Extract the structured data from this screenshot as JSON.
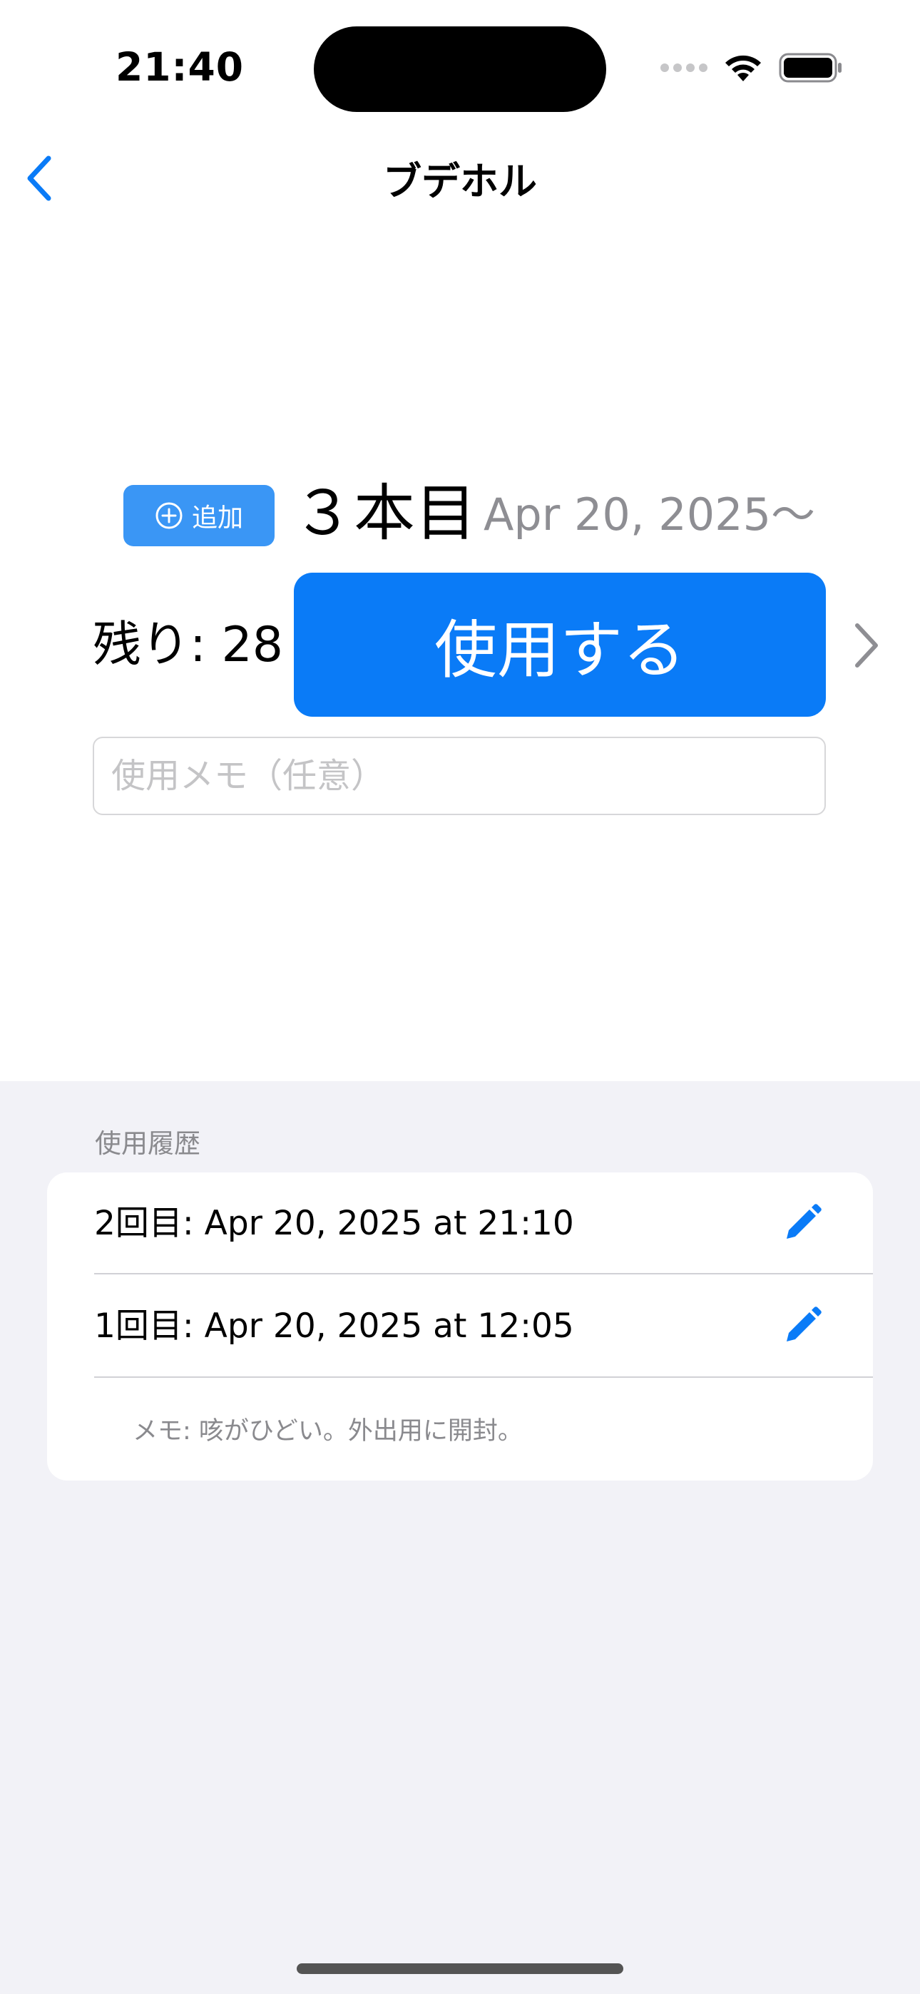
{
  "status_bar": {
    "time": "21:40"
  },
  "nav": {
    "title": "ブデホル",
    "back_icon": "chevron-left-icon"
  },
  "bottle": {
    "add_label": "追加",
    "add_icon": "plus-circle-icon",
    "label": "３本目",
    "start_date": "Apr 20, 2025〜",
    "remaining": "残り: 28",
    "use_button_label": "使用する",
    "next_icon": "chevron-right-icon"
  },
  "memo": {
    "placeholder": "使用メモ（任意）",
    "value": ""
  },
  "history": {
    "header": "使用履歴",
    "items": [
      {
        "text": "2回目: Apr 20, 2025 at 21:10",
        "edit_icon": "pencil-icon"
      },
      {
        "text": "1回目: Apr 20, 2025 at 12:05",
        "edit_icon": "pencil-icon"
      }
    ],
    "memo_text": "メモ: 咳がひどい。外出用に開封。"
  },
  "colors": {
    "accent": "#0a7bf7",
    "add_button": "#3a96f5",
    "grouped_background": "#f2f2f7",
    "secondary_text": "#8e8e93"
  }
}
